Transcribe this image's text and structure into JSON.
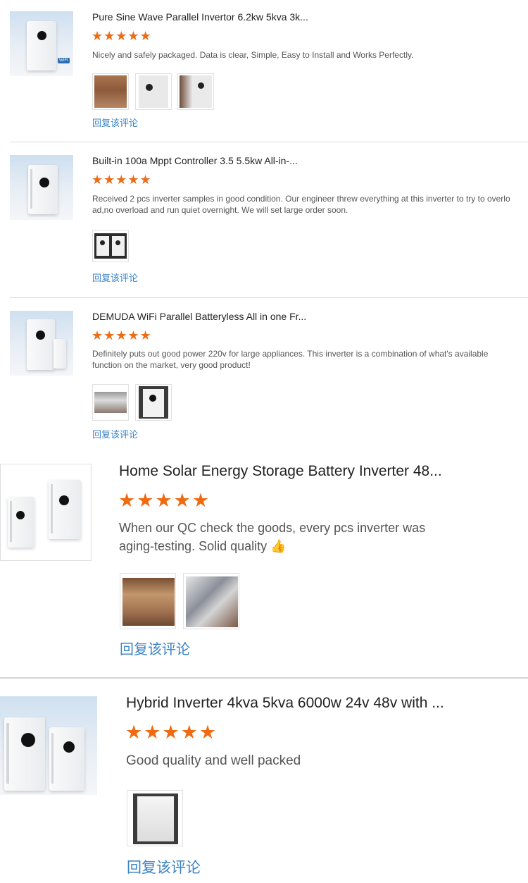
{
  "reviews": [
    {
      "product_title": "Pure Sine Wave Parallel Invertor 6.2kw 5kva 3k...",
      "stars": "★★★★★",
      "text": "Nicely and safely packaged. Data is clear, Simple, Easy to Install and Works Perfectly.",
      "reply_label": "回复该评论",
      "thumb_badge": "WIFI"
    },
    {
      "product_title": "Built-in 100a Mppt Controller 3.5 5.5kw All-in-...",
      "stars": "★★★★★",
      "text": "Received 2 pcs inverter samples in good condition. Our engineer threw everything at this inverter to try to overload,no overload and run quiet overnight. We will set large order soon.",
      "reply_label": "回复该评论"
    },
    {
      "product_title": "DEMUDA WiFi Parallel Batteryless All in one Fr...",
      "stars": "★★★★★",
      "text": "Definitely puts out good power 220v for large appliances.  This inverter is a combination of what's available function on the market, very good product!",
      "reply_label": "回复该评论"
    },
    {
      "product_title": "Home Solar Energy Storage Battery Inverter 48...",
      "stars": "★★★★★",
      "text": "When our QC check the goods, every pcs inverter was aging-testing. Solid quality",
      "reply_label": "回复该评论"
    },
    {
      "product_title": "Hybrid Inverter 4kva 5kva 6000w 24v 48v with ...",
      "stars": "★★★★★",
      "text": "Good quality and well packed",
      "reply_label": "回复该评论"
    }
  ]
}
